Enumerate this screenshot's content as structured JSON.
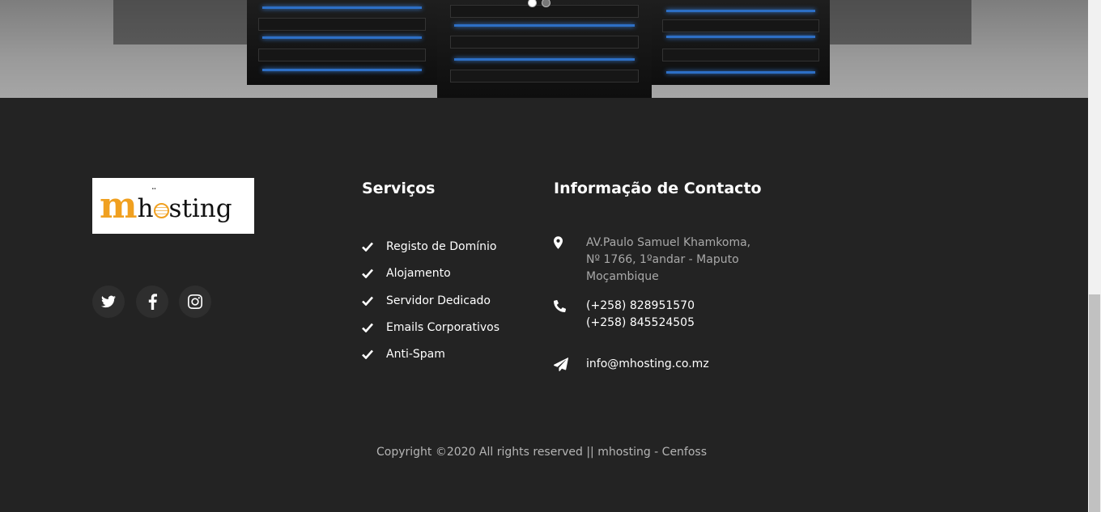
{
  "hero": {
    "carousel_dots": 2,
    "active_dot": 1
  },
  "footer": {
    "logo_text": {
      "m": "m",
      "rest": "hosting"
    },
    "social": [
      {
        "icon": "twitter-icon"
      },
      {
        "icon": "facebook-icon"
      },
      {
        "icon": "instagram-icon"
      }
    ],
    "services": {
      "title": "Serviços",
      "items": [
        "Registo de Domínio",
        "Alojamento",
        "Servidor Dedicado",
        "Emails Corporativos",
        "Anti-Spam"
      ]
    },
    "contact": {
      "title": "Informação de Contacto",
      "address": [
        "AV.Paulo Samuel Khamkoma,",
        "Nº 1766, 1ºandar - Maputo",
        "Moçambique"
      ],
      "phones": [
        "(+258) 828951570",
        "(+258) 845524505"
      ],
      "email": "info@mhosting.co.mz"
    },
    "copyright": "Copyright ©2020 All rights reserved || mhosting - Cenfoss"
  },
  "colors": {
    "footer_bg": "#232323",
    "brand_orange": "#f0a020"
  }
}
